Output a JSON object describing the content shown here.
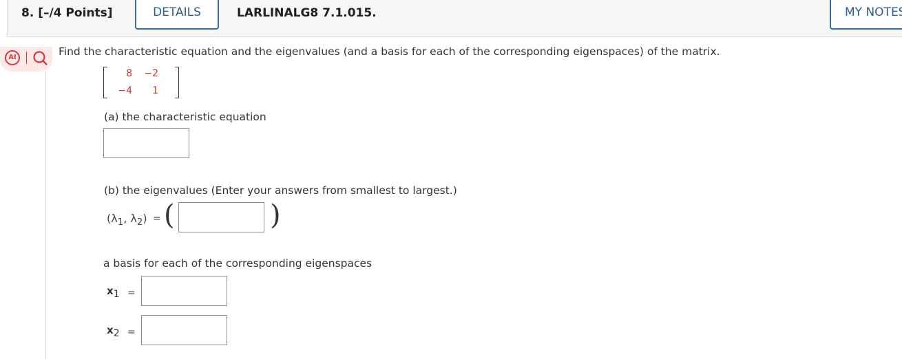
{
  "header": {
    "question_number": "8.  [–/4 Points]",
    "details_label": "DETAILS",
    "question_id": "LARLINALG8 7.1.015.",
    "my_notes_label": "MY NOTES"
  },
  "tools": {
    "ai_label": "AI"
  },
  "question": {
    "prompt": "Find the characteristic equation and the eigenvalues (and a basis for each of the corresponding eigenspaces) of the matrix.",
    "matrix": [
      [
        "8",
        "−2"
      ],
      [
        "−4",
        "1"
      ]
    ],
    "part_a_label": "(a) the characteristic equation",
    "part_b_label": "(b) the eigenvalues (Enter your answers from smallest to largest.)",
    "lambda_pair": "(λ",
    "lambda_sub1": "1",
    "lambda_comma": ", λ",
    "lambda_sub2": "2",
    "lambda_close": ")",
    "equals": "=",
    "basis_label": "a basis for each of the corresponding eigenspaces",
    "x_var": "x",
    "x1_sub": "1",
    "x2_sub": "2"
  },
  "inputs": {
    "characteristic_equation": "",
    "eigenvalues": "",
    "x1_basis": "",
    "x2_basis": ""
  },
  "colors": {
    "accent_blue": "#2f5f90",
    "ai_red": "#d3393d",
    "matrix_red": "#c0392b"
  }
}
